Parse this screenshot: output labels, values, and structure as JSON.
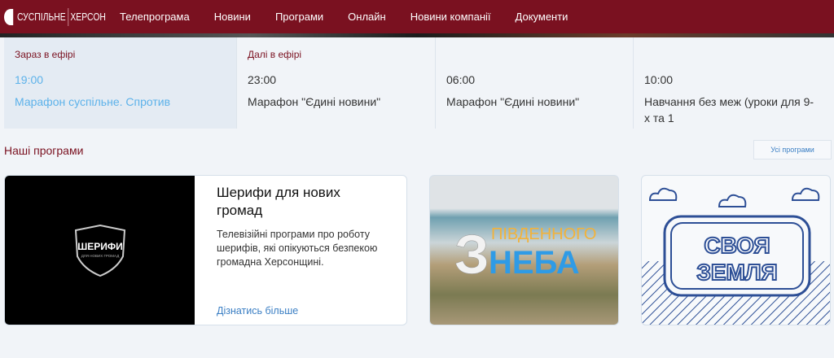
{
  "header": {
    "logo_left": "СУСПІЛЬНЕ",
    "logo_right": "ХЕРСОН",
    "nav": [
      "Телепрограма",
      "Новини",
      "Програми",
      "Онлайн",
      "Новини компанії",
      "Документи"
    ]
  },
  "schedule": {
    "now_label": "Зараз в ефірі",
    "next_label": "Далі в ефірі",
    "items": [
      {
        "time": "19:00",
        "title": "Марафон суспільне. Спротив"
      },
      {
        "time": "23:00",
        "title": "Марафон \"Єдині новини\""
      },
      {
        "time": "06:00",
        "title": "Марафон \"Єдині новини\""
      },
      {
        "time": "10:00",
        "title": "Навчання без меж (уроки для 9-х та 1"
      }
    ]
  },
  "programs": {
    "heading": "Наші програми",
    "all_button": "Усі програми",
    "featured": {
      "title": "Шерифи для нових громад",
      "description": "Телевізійні програми про роботу шерифів, які опікуються безпекою громадна Херсонщині.",
      "link": "Дізнатись більше",
      "logo_text": "ШЕРИФИ",
      "logo_sub": "ДЛЯ НОВИХ ГРОМАД"
    },
    "card2": {
      "logo_top": "ПІВДЕННОГО",
      "logo_num": "З",
      "logo_bottom": "НЕБА"
    },
    "card3": {
      "logo_line1": "СВОЯ",
      "logo_line2": "ЗЕМЛЯ"
    }
  },
  "colors": {
    "brand": "#7a1120",
    "accent": "#5db2ea",
    "link": "#3b7fc4"
  }
}
